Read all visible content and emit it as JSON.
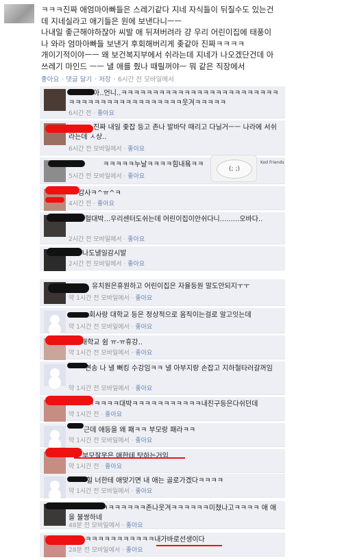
{
  "post": {
    "lines": [
      "ㅋㅋㅋ진짜 애엄마아빠들은 스레기같다 지네 자식들이 뒤질수도 있는건",
      "데 지네실라고 애기들은 원에 보낸다니ㅡㅡ",
      "나내일 좋근해야하잖아 씨발 애 뒤져버려라 걍 우리 어린이집에 태풍이",
      "나 와라 엄마아빠들 보낸거 후회해버리게 좆같아 진짜ㅋㅋㅋㅋ",
      "개이기적이야ㅡㅡ 왜 보건복지부에서 쉬라는데 지네가 나오겠단건데 아",
      "쓰레기 마인드 ㅡㅡ 낼 애를 줬나 때릴꺼야ㅡ 뭐 같은 직장에서"
    ],
    "actions": [
      "좋아요",
      "댓글 달기",
      "저장"
    ],
    "meta": "6시간 전 모바일에서"
  },
  "comments": [
    {
      "text": "아..언니..ㅋㅋㅋㅋㅋㅋㅋㅋㅋㅋㅋㅋㅋㅋㅋㅋㅋㅋㅋㅋㅋㅋㅋㅋㅋㅋㅋㅋㅋㅋㅋㅋㅋㅋㅋㅋㅋㅋㅋㅋㅋㅋㅋ웃겨ㅋㅋㅋㅋㅋ",
      "time": "6시간 전",
      "like": "좋아요"
    },
    {
      "text": "진짜 내일 좇잡 등고 존나 발바닥 때리고 다닐거ㅡㅡ 나라에 서쉬라는데 ㅅ상..",
      "time": "6시간 전 모바일에서",
      "like": "좋아요"
    },
    {
      "text": "ㅋㅋㅋㅋㅋ누날ㅋㅋㅋㅋ힘내욬ㅋㅋ",
      "time": "5시간 전 모바일에서",
      "like": "좋아요"
    },
    {
      "text": "감사ㅋ^ㅠ^ㅋ",
      "time": "4시간 전",
      "like": "좋아요"
    },
    {
      "text": "헐대박...우리센터도쉬는데 어린이집이안쉬다니.........오바다..",
      "time": "2시간 전 모바일에서",
      "like": "좋아요"
    },
    {
      "text": "나도낼일감시발",
      "time": "2시간 전 모바일에서",
      "like": "좋아요"
    },
    {
      "text": "유치원은휴원하고 어린이집은 자율등원 말도안되지ㅜㅜ",
      "time": "약 1시간 전 모바일에서",
      "like": "좋아요"
    },
    {
      "text": "회사랑 대학교 등은 정상적으로 움직이는걸로 알고잇는데",
      "time": "약 1시간 전 모바일에서",
      "like": "좋아요"
    },
    {
      "text": "대학교 쉼 ㅠ-ㅠ휴강..",
      "time": "약 1시간 전 모바일에서",
      "like": "좋아요"
    },
    {
      "text": "면송 나 낼 뻐킹 수강임ㅋㅋ 낼 아부지랑 손잡고 지하철타러갈꺼임",
      "time": "약 1시간 전 모바일에서",
      "like": "좋아요"
    },
    {
      "text": "ㅋㅋㅋㅋㅋ대박ㅋㅋㅋㅋㅋㅋㅋㅋㅋㅋㅋ내친구등은다쉬던데",
      "time": "약 1시간 전",
      "like": "좋아요"
    },
    {
      "text": "근데 애등을 왜 패ㅋㅋ 부모랑 패라ㅋㅋ",
      "time": "약 1시간 전 모바일에서",
      "like": "좋아요"
    },
    {
      "text": "부모잘못은 애한테 탓하는거임",
      "time": "약 1시간 전",
      "like": "좋아요"
    },
    {
      "text": "헐 너한테 애맞기면 내 애는 골로가겠다ㅋㅋㅋㅋ",
      "time": "약 1시간 전 모바일에서",
      "like": "좋아요"
    },
    {
      "text": "ㅋㅋㅋㅋㅋㅋㅋㅋㅋ존나웃겨ㅋㅋㅋㅋㅋㅋ미쳤나고ㅋㅋㅋㅋ 애 애을 불쌍하네",
      "time": "48분 전 모바일에서",
      "like": "좋아요"
    },
    {
      "text": "ㅋㅋㅋㅋㅋㅋㅋㅋㅋㅋㅋ내가바로선생이다",
      "time": "28분 전 모바일에서",
      "like": "좋아요"
    }
  ],
  "emoticon_caption": "Kod Friends",
  "colors": {
    "link": "#6d84b4",
    "comment_bg": "#edeff4",
    "redaction": "#e11111"
  }
}
